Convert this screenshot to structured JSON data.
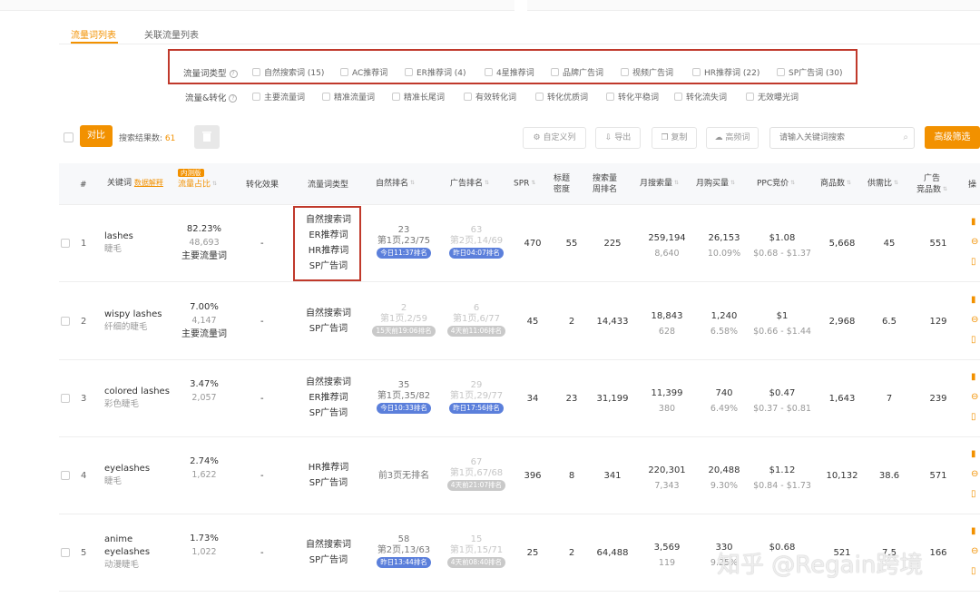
{
  "tabs": [
    {
      "label": "流量词列表",
      "active": true
    },
    {
      "label": "关联流量列表",
      "active": false
    }
  ],
  "filters": {
    "type_label": "流量词类型",
    "type_options": [
      "自然搜索词 (15)",
      "AC推荐词",
      "ER推荐词 (4)",
      "4星推荐词",
      "品牌广告词",
      "视频广告词",
      "HR推荐词 (22)",
      "SP广告词 (30)"
    ],
    "conversion_label": "流量&转化",
    "conversion_options": [
      "主要流量词",
      "精准流量词",
      "精准长尾词",
      "有效转化词",
      "转化优质词",
      "转化平稳词",
      "转化流失词",
      "无效曝光词"
    ]
  },
  "toolbar": {
    "compare_label": "对比",
    "result_label": "搜索结果数:",
    "result_count": "61",
    "custom_label": "自定义列",
    "export_label": "导出",
    "copy_label": "复制",
    "wordcloud_label": "高频词",
    "search_placeholder": "请输入关键词搜索",
    "advanced_label": "高级筛选"
  },
  "headers": {
    "index": "#",
    "keyword": "关键词",
    "keyword_link": "数据解释",
    "new_badge": "内测版",
    "share": "流量占比",
    "effect": "转化效果",
    "type": "流量词类型",
    "natural_rank": "自然排名",
    "ad_rank": "广告排名",
    "spr": "SPR",
    "title_density_1": "标题",
    "title_density_2": "密度",
    "search_rank_1": "搜索量",
    "search_rank_2": "周排名",
    "monthly_search": "月搜索量",
    "monthly_purchase": "月购买量",
    "ppc": "PPC竞价",
    "products": "商品数",
    "supply_ratio": "供需比",
    "ad_products_1": "广告",
    "ad_products_2": "竞品数",
    "ops": "操"
  },
  "rows": [
    {
      "index": "1",
      "kw_lines": [
        "lashes"
      ],
      "kw_cn": "睫毛",
      "share_pct": "82.23%",
      "share_num": "48,693",
      "share_tag": "主要流量词",
      "effect": "-",
      "types": [
        "自然搜索词",
        "ER推荐词",
        "HR推荐词",
        "SP广告词"
      ],
      "nat_rank": "23",
      "nat_page": "第1页,23/75",
      "nat_pill": "今日11:37排名",
      "nat_faded": false,
      "ad_rank": "63",
      "ad_page": "第2页,14/69",
      "ad_pill": "昨日04:07排名",
      "ad_faded": true,
      "ad_pill_blue": true,
      "spr": "470",
      "density": "55",
      "weekly": "225",
      "msearch": "259,194",
      "msearch_sub": "8,640",
      "mbuy": "26,153",
      "mbuy_sub": "10.09%",
      "ppc": "$1.08",
      "ppc_range": "$0.68 - $1.37",
      "products": "5,668",
      "ratio": "45",
      "adprod": "551"
    },
    {
      "index": "2",
      "kw_lines": [
        "wispy lashes"
      ],
      "kw_cn": "纤细的睫毛",
      "share_pct": "7.00%",
      "share_num": "4,147",
      "share_tag": "主要流量词",
      "effect": "-",
      "types": [
        "自然搜索词",
        "SP广告词"
      ],
      "nat_rank": "2",
      "nat_page": "第1页,2/59",
      "nat_pill": "15天前19:06排名",
      "nat_faded": true,
      "ad_rank": "6",
      "ad_page": "第1页,6/77",
      "ad_pill": "4天前11:06排名",
      "ad_faded": true,
      "ad_pill_blue": false,
      "spr": "45",
      "density": "2",
      "weekly": "14,433",
      "msearch": "18,843",
      "msearch_sub": "628",
      "mbuy": "1,240",
      "mbuy_sub": "6.58%",
      "ppc": "$1",
      "ppc_range": "$0.66 - $1.44",
      "products": "2,968",
      "ratio": "6.5",
      "adprod": "129"
    },
    {
      "index": "3",
      "kw_lines": [
        "colored lashes"
      ],
      "kw_cn": "彩色睫毛",
      "share_pct": "3.47%",
      "share_num": "2,057",
      "share_tag": "",
      "effect": "-",
      "types": [
        "自然搜索词",
        "ER推荐词",
        "SP广告词"
      ],
      "nat_rank": "35",
      "nat_page": "第1页,35/82",
      "nat_pill": "今日10:33排名",
      "nat_faded": false,
      "ad_rank": "29",
      "ad_page": "第1页,29/77",
      "ad_pill": "昨日17:56排名",
      "ad_faded": true,
      "ad_pill_blue": true,
      "spr": "34",
      "density": "23",
      "weekly": "31,199",
      "msearch": "11,399",
      "msearch_sub": "380",
      "mbuy": "740",
      "mbuy_sub": "6.49%",
      "ppc": "$0.47",
      "ppc_range": "$0.37 - $0.81",
      "products": "1,643",
      "ratio": "7",
      "adprod": "239"
    },
    {
      "index": "4",
      "kw_lines": [
        "eyelashes"
      ],
      "kw_cn": "睫毛",
      "share_pct": "2.74%",
      "share_num": "1,622",
      "share_tag": "",
      "effect": "-",
      "types": [
        "HR推荐词",
        "SP广告词"
      ],
      "nat_rank": "",
      "nat_page": "前3页无排名",
      "nat_pill": "",
      "nat_faded": false,
      "ad_rank": "67",
      "ad_page": "第1页,67/68",
      "ad_pill": "4天前21:07排名",
      "ad_faded": true,
      "ad_pill_blue": false,
      "spr": "396",
      "density": "8",
      "weekly": "341",
      "msearch": "220,301",
      "msearch_sub": "7,343",
      "mbuy": "20,488",
      "mbuy_sub": "9.30%",
      "ppc": "$1.12",
      "ppc_range": "$0.84 - $1.73",
      "products": "10,132",
      "ratio": "38.6",
      "adprod": "571"
    },
    {
      "index": "5",
      "kw_lines": [
        "anime",
        "eyelashes"
      ],
      "kw_cn": "动漫睫毛",
      "share_pct": "1.73%",
      "share_num": "1,022",
      "share_tag": "",
      "effect": "-",
      "types": [
        "自然搜索词",
        "SP广告词"
      ],
      "nat_rank": "58",
      "nat_page": "第2页,13/63",
      "nat_pill": "昨日13:44排名",
      "nat_faded": false,
      "ad_rank": "15",
      "ad_page": "第1页,15/71",
      "ad_pill": "4天前08:40排名",
      "ad_faded": true,
      "ad_pill_blue": false,
      "spr": "25",
      "density": "2",
      "weekly": "64,488",
      "msearch": "3,569",
      "msearch_sub": "119",
      "mbuy": "330",
      "mbuy_sub": "9.25%",
      "ppc": "$0.68",
      "ppc_range": "",
      "products": "521",
      "ratio": "7.5",
      "adprod": "166"
    }
  ],
  "watermark": "知乎 @Regain跨境",
  "colors": {
    "accent": "#f29100",
    "highlight_border": "#c0392b",
    "pill_blue": "#5b7fdb",
    "pill_grey": "#c9c9c9"
  }
}
